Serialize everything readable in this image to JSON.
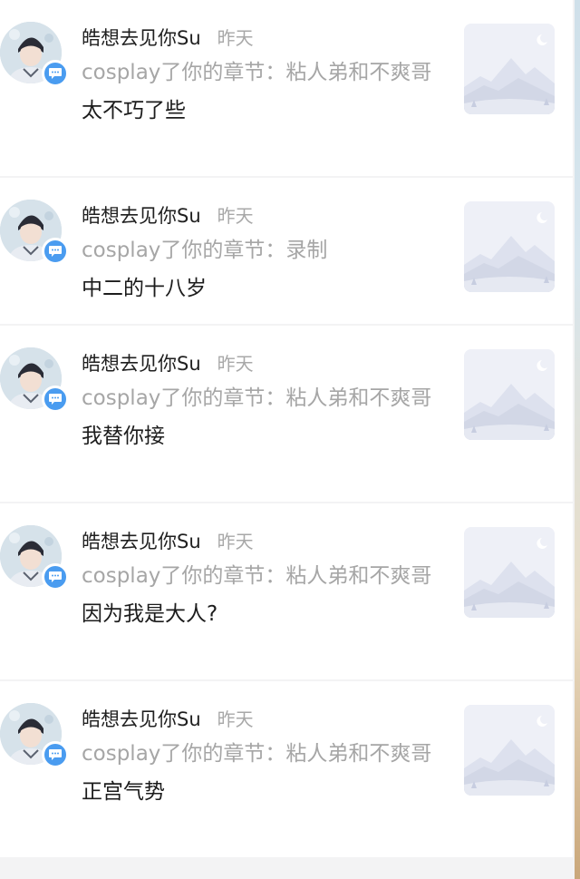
{
  "colors": {
    "page_background": "#f3f3f4",
    "card_background": "#ffffff",
    "author_text": "#1f1f1f",
    "time_text": "#a8a8a8",
    "action_text": "#a6a6a6",
    "comment_text": "#1c1c1c",
    "badge_blue": "#4a9cf0",
    "thumbnail_tint": "#eef0f7"
  },
  "icons": {
    "badge": "chat-bubble-icon",
    "avatar": "user-avatar-icon",
    "thumbnail": "mountain-placeholder-icon"
  },
  "notifications": [
    {
      "author": "皓想去见你Su",
      "time": "昨天",
      "action": "cosplay了你的章节：粘人弟和不爽哥",
      "comment": "太不巧了些"
    },
    {
      "author": "皓想去见你Su",
      "time": "昨天",
      "action": "cosplay了你的章节：录制",
      "comment": "中二的十八岁"
    },
    {
      "author": "皓想去见你Su",
      "time": "昨天",
      "action": "cosplay了你的章节：粘人弟和不爽哥",
      "comment": "我替你接"
    },
    {
      "author": "皓想去见你Su",
      "time": "昨天",
      "action": "cosplay了你的章节：粘人弟和不爽哥",
      "comment": "因为我是大人?"
    },
    {
      "author": "皓想去见你Su",
      "time": "昨天",
      "action": "cosplay了你的章节：粘人弟和不爽哥",
      "comment": "正宫气势"
    }
  ]
}
